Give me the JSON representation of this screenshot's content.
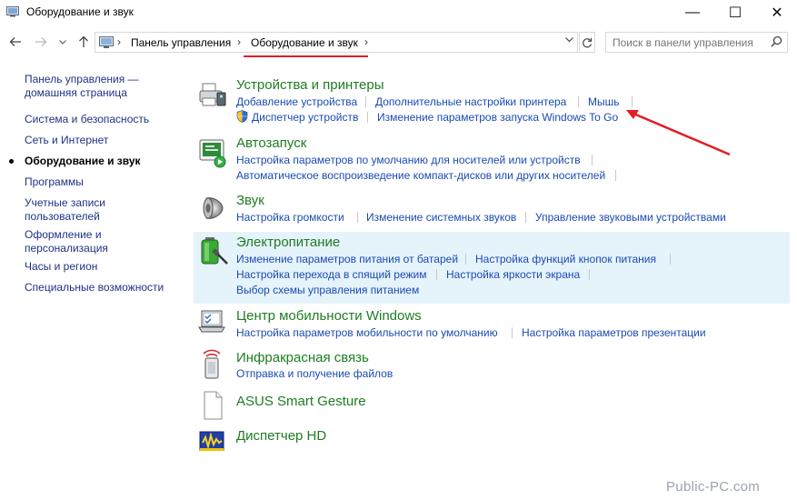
{
  "window": {
    "title": "Оборудование и звук",
    "minimize_glyph": "—",
    "maximize_glyph": "☐",
    "close_glyph": "✕"
  },
  "address": {
    "separator": "›",
    "crumbs": [
      "Панель управления",
      "Оборудование и звук"
    ],
    "search_placeholder": "Поиск в панели управления"
  },
  "sidebar": {
    "items": [
      {
        "label": "Панель управления — домашняя страница"
      },
      {
        "label": "Система и безопасность"
      },
      {
        "label": "Сеть и Интернет"
      },
      {
        "label": "Оборудование и звук",
        "current": true
      },
      {
        "label": "Программы"
      },
      {
        "label": "Учетные записи пользователей"
      },
      {
        "label": "Оформление и персонализация"
      },
      {
        "label": "Часы и регион"
      },
      {
        "label": "Специальные возможности"
      }
    ]
  },
  "categories": [
    {
      "title": "Устройства и принтеры",
      "icon": "printer-icon",
      "links": [
        "Добавление устройства",
        "Дополнительные настройки принтера",
        "Мышь",
        "Диспетчер устройств",
        "Изменение параметров запуска Windows To Go"
      ]
    },
    {
      "title": "Автозапуск",
      "icon": "autoplay-icon",
      "links": [
        "Настройка параметров по умолчанию для носителей или устройств",
        "Автоматическое воспроизведение компакт-дисков или других носителей"
      ]
    },
    {
      "title": "Звук",
      "icon": "speaker-icon",
      "links": [
        "Настройка громкости",
        "Изменение системных звуков",
        "Управление звуковыми устройствами"
      ]
    },
    {
      "title": "Электропитание",
      "icon": "battery-icon",
      "links": [
        "Изменение параметров питания от батарей",
        "Настройка функций кнопок питания",
        "Настройка перехода в спящий режим",
        "Настройка яркости экрана",
        "Выбор схемы управления питанием"
      ]
    },
    {
      "title": "Центр мобильности Windows",
      "icon": "mobility-center-icon",
      "links": [
        "Настройка параметров мобильности по умолчанию",
        "Настройка параметров презентации"
      ]
    },
    {
      "title": "Инфракрасная связь",
      "icon": "infrared-icon",
      "links": [
        "Отправка и получение файлов"
      ]
    },
    {
      "title": "ASUS Smart Gesture",
      "icon": "blank-document-icon",
      "links": []
    },
    {
      "title": "Диспетчер HD",
      "icon": "hd-audio-manager-icon",
      "links": []
    }
  ],
  "colors": {
    "heading_green": "#1e7d22",
    "link_blue": "#1a4ab5",
    "nav_blue": "#1e3287",
    "highlight_bg": "#e5f3fb",
    "annotation_red": "#e31e24"
  },
  "watermark": "Public-PC.com"
}
